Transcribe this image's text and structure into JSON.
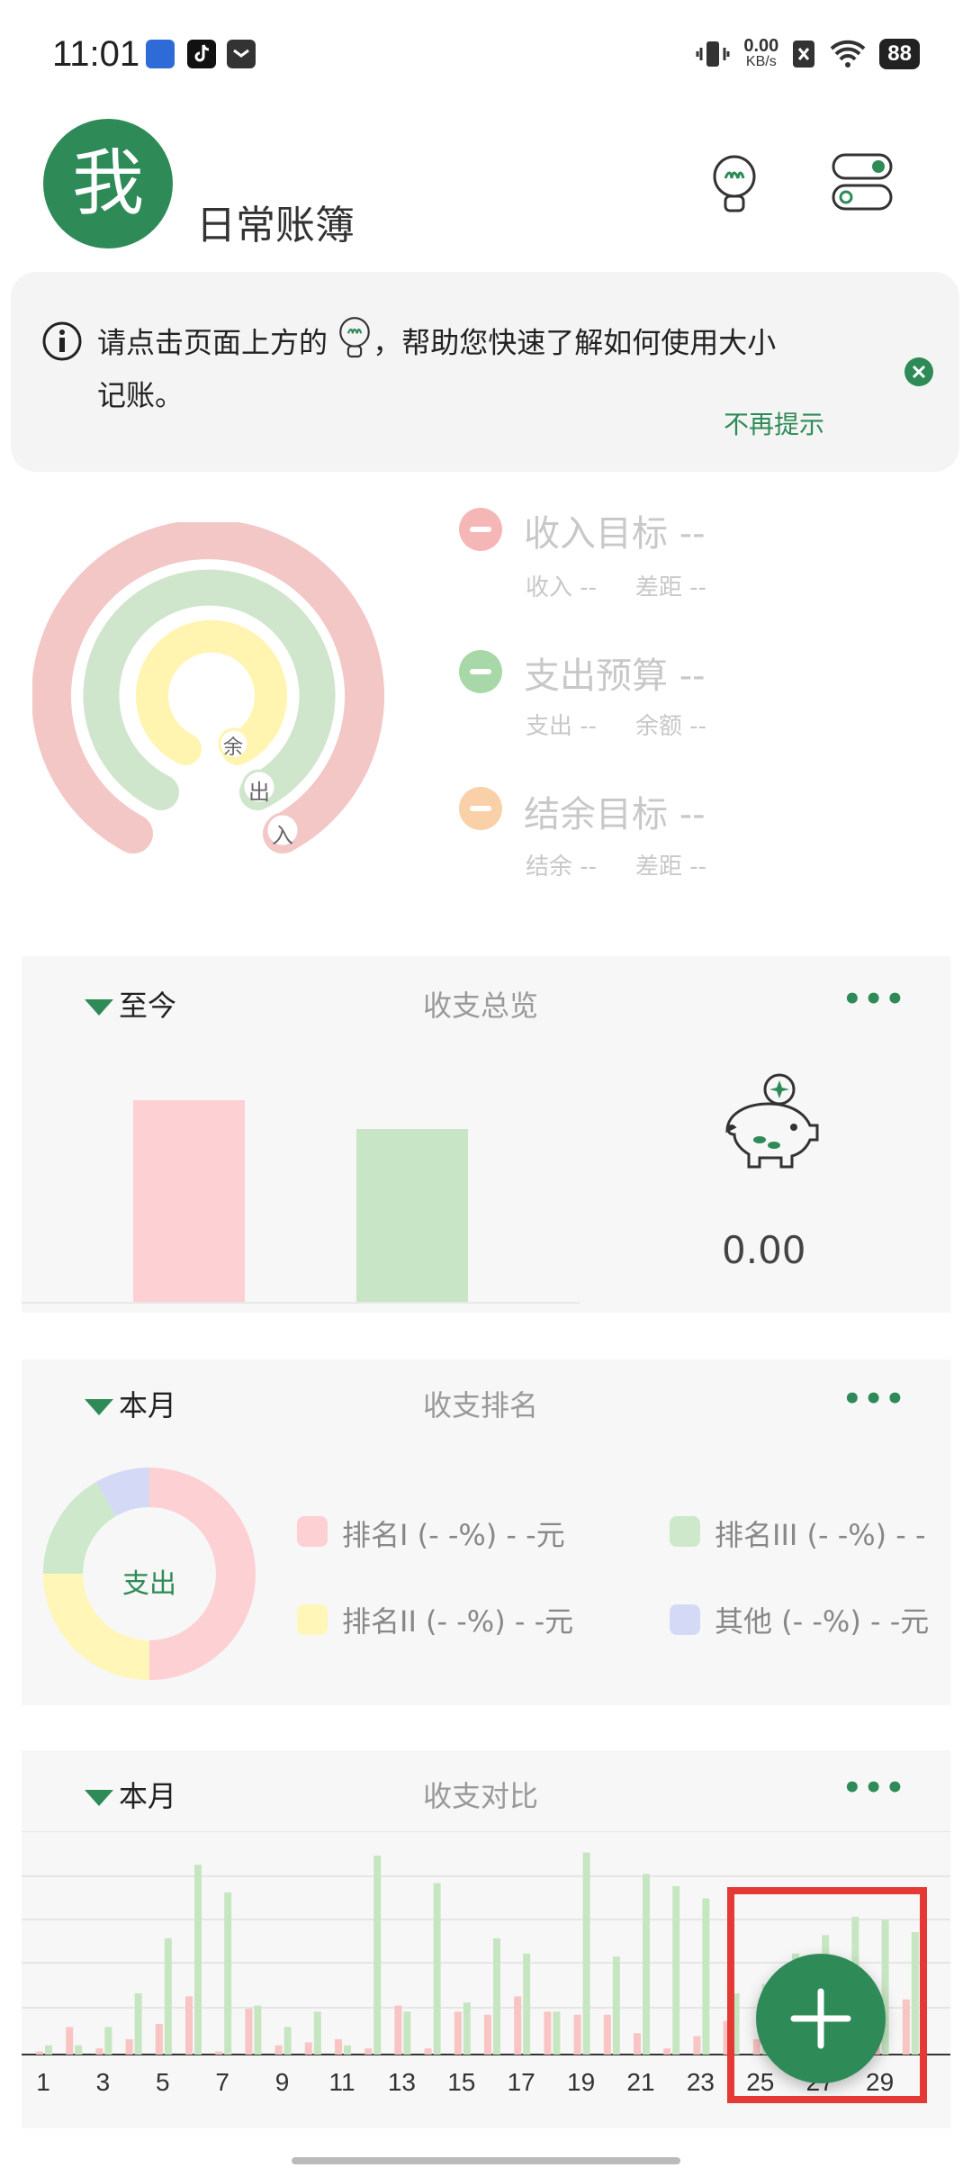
{
  "status_bar": {
    "time": "11:01",
    "net_speed_value": "0.00",
    "net_speed_unit": "KB/s",
    "battery": "88"
  },
  "header": {
    "avatar_text": "我",
    "title": "日常账簿"
  },
  "tip": {
    "text": "请点击页面上方的 ，帮助您快速了解如何使用大小记账。",
    "line1": "请点击页面上方的",
    "line1_tail": "，帮助您快速了解如何使用大小",
    "line2": "记账。",
    "dismiss_label": "不再提示"
  },
  "rings": {
    "labels": [
      "余",
      "出",
      "入"
    ],
    "colors": {
      "income": "#f3c7c5",
      "expense": "#cfe6cc",
      "balance": "#fff5b0"
    }
  },
  "goals": [
    {
      "title": "收入目标 --",
      "sub_left": "收入 --",
      "sub_right": "差距 --",
      "color": "#f4b7b5"
    },
    {
      "title": "支出预算 --",
      "sub_left": "支出 --",
      "sub_right": "余额 --",
      "color": "#a8d8a8"
    },
    {
      "title": "结余目标 --",
      "sub_left": "结余 --",
      "sub_right": "差距 --",
      "color": "#f9d0a8"
    }
  ],
  "overview": {
    "range": "至今",
    "title": "收支总览",
    "more": "•••",
    "balance": "0.00",
    "bar_heights_pct": [
      100,
      86
    ]
  },
  "ranking": {
    "range": "本月",
    "title": "收支排名",
    "more": "•••",
    "center_label": "支出",
    "legend": [
      {
        "label": "排名I (- -%) - -元",
        "color": "#fdd0d4"
      },
      {
        "label": "排名III (- -%) - -",
        "color": "#cde8cb"
      },
      {
        "label": "排名II (- -%) - -元",
        "color": "#fff6b8"
      },
      {
        "label": "其他 (- -%) - -元",
        "color": "#d4daf5"
      }
    ]
  },
  "comparison": {
    "range": "本月",
    "title": "收支对比",
    "more": "•••",
    "x_labels": [
      "1",
      "3",
      "5",
      "7",
      "9",
      "11",
      "13",
      "15",
      "17",
      "19",
      "21",
      "23",
      "25",
      "27",
      "29"
    ],
    "chart_data": {
      "type": "bar",
      "x": [
        1,
        2,
        3,
        4,
        5,
        6,
        7,
        8,
        9,
        10,
        11,
        12,
        13,
        14,
        15,
        16,
        17,
        18,
        19,
        20,
        21,
        22,
        23,
        24,
        25,
        26,
        27,
        28,
        29,
        30
      ],
      "series": [
        {
          "values": [
            1,
            9,
            2,
            5,
            10,
            19,
            1,
            15,
            3,
            4,
            5,
            2,
            16,
            2,
            14,
            13,
            19,
            14,
            13,
            13,
            7,
            2,
            6,
            11,
            5,
            13,
            16,
            16,
            16,
            18
          ]
        },
        {
          "values": [
            3,
            3,
            9,
            20,
            38,
            62,
            53,
            16,
            9,
            14,
            3,
            65,
            14,
            56,
            17,
            38,
            33,
            14,
            66,
            32,
            59,
            55,
            51,
            20,
            23,
            33,
            39,
            45,
            44,
            40
          ]
        }
      ],
      "colors": [
        "#f8c4c4",
        "#c6e6c2"
      ]
    }
  }
}
